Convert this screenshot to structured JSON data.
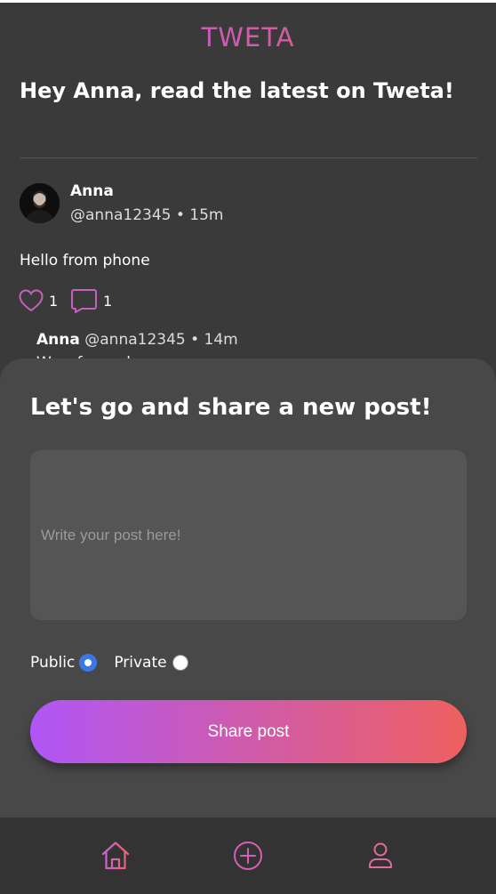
{
  "app": {
    "logo": "TWETA"
  },
  "feed": {
    "greeting": "Hey Anna, read the latest on Tweta!",
    "post": {
      "author_name": "Anna",
      "author_meta": "@anna12345 • 15m",
      "text": "Hello from phone",
      "like_count": "1",
      "comment_count": "1",
      "avatar_icon": "user-photo"
    },
    "reply": {
      "author_name": "Anna",
      "author_meta": "@anna12345 • 14m",
      "text": "Wow from phone"
    }
  },
  "composer": {
    "title": "Let's go and share a new post!",
    "placeholder": "Write your post here!",
    "value": "",
    "visibility_options": [
      {
        "label": "Public",
        "selected": true
      },
      {
        "label": "Private",
        "selected": false
      }
    ],
    "submit_label": "Share post"
  },
  "nav": {
    "items": [
      {
        "icon": "home-icon"
      },
      {
        "icon": "add-circle-icon"
      },
      {
        "icon": "profile-icon"
      }
    ]
  },
  "colors": {
    "background": "#3a3a3a",
    "sheet": "#484848",
    "gradient_start": "#b056f7",
    "gradient_end": "#ee605f",
    "icon_pink": "#e66aa8",
    "radio_selected": "#3b78e7"
  }
}
